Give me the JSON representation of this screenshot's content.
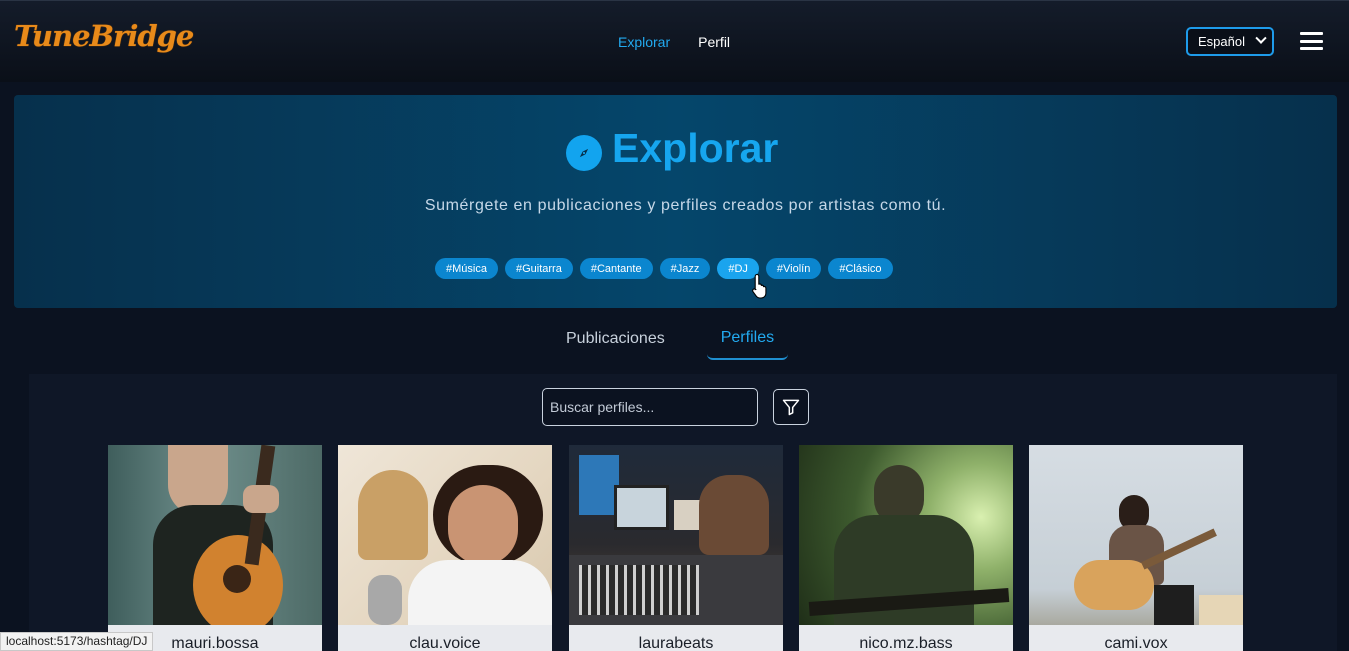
{
  "nav": {
    "logo": "TuneBridge",
    "links": [
      {
        "label": "Explorar",
        "active": true
      },
      {
        "label": "Perfil",
        "active": false
      }
    ],
    "language": "Español"
  },
  "hero": {
    "title": "Explorar",
    "icon": "compass-icon",
    "subtitle": "Sumérgete en publicaciones y perfiles creados por artistas como tú.",
    "tags": [
      "#Música",
      "#Guitarra",
      "#Cantante",
      "#Jazz",
      "#DJ",
      "#Violín",
      "#Clásico"
    ]
  },
  "tabs": {
    "posts": "Publicaciones",
    "profiles": "Perfiles",
    "active": "Perfiles"
  },
  "search": {
    "placeholder": "Buscar perfiles...",
    "value": ""
  },
  "profiles": [
    {
      "username": "mauri.bossa"
    },
    {
      "username": "clau.voice"
    },
    {
      "username": "laurabeats"
    },
    {
      "username": "nico.mz.bass"
    },
    {
      "username": "cami.vox"
    }
  ],
  "status_bar": "localhost:5173/hashtag/DJ",
  "colors": {
    "accent": "#16a6ef",
    "tag_bg": "#0b86cf",
    "logo": "#e88a1a",
    "background": "#0b1220"
  }
}
